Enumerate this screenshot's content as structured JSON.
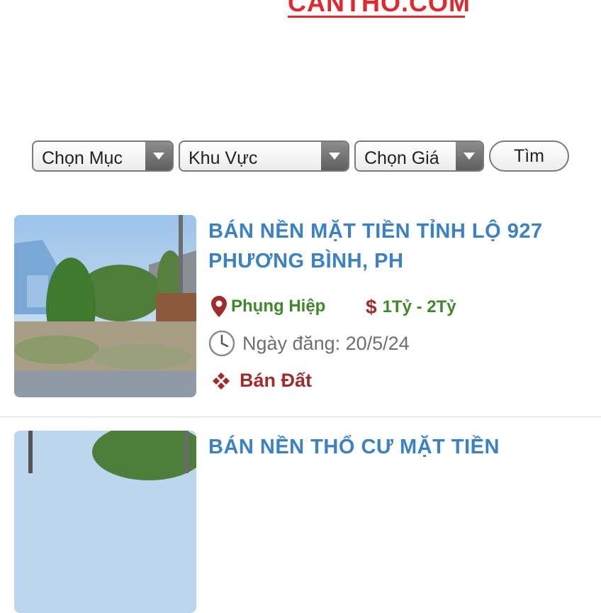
{
  "header": {
    "logo_text": "CANTHO.COM"
  },
  "filters": {
    "category_label": "Chọn Mục",
    "area_label": "Khu Vực",
    "price_label": "Chọn Giá",
    "search_label": "Tìm"
  },
  "listings": [
    {
      "title": "BÁN NỀN MẶT TIỀN TỈNH LỘ 927 PHƯƠNG BÌNH, PH",
      "location": "Phụng Hiệp",
      "price": "1Tỷ - 2Tỷ",
      "date": "Ngày đăng: 20/5/24",
      "type": "Bán Đất"
    },
    {
      "title": "BÁN NỀN THỔ CƯ MẶT TIỀN"
    }
  ],
  "colors": {
    "title_blue": "#3a82c4",
    "green": "#3e8a2a",
    "dark_red": "#a12a2a",
    "logo_red": "#e0282e"
  }
}
